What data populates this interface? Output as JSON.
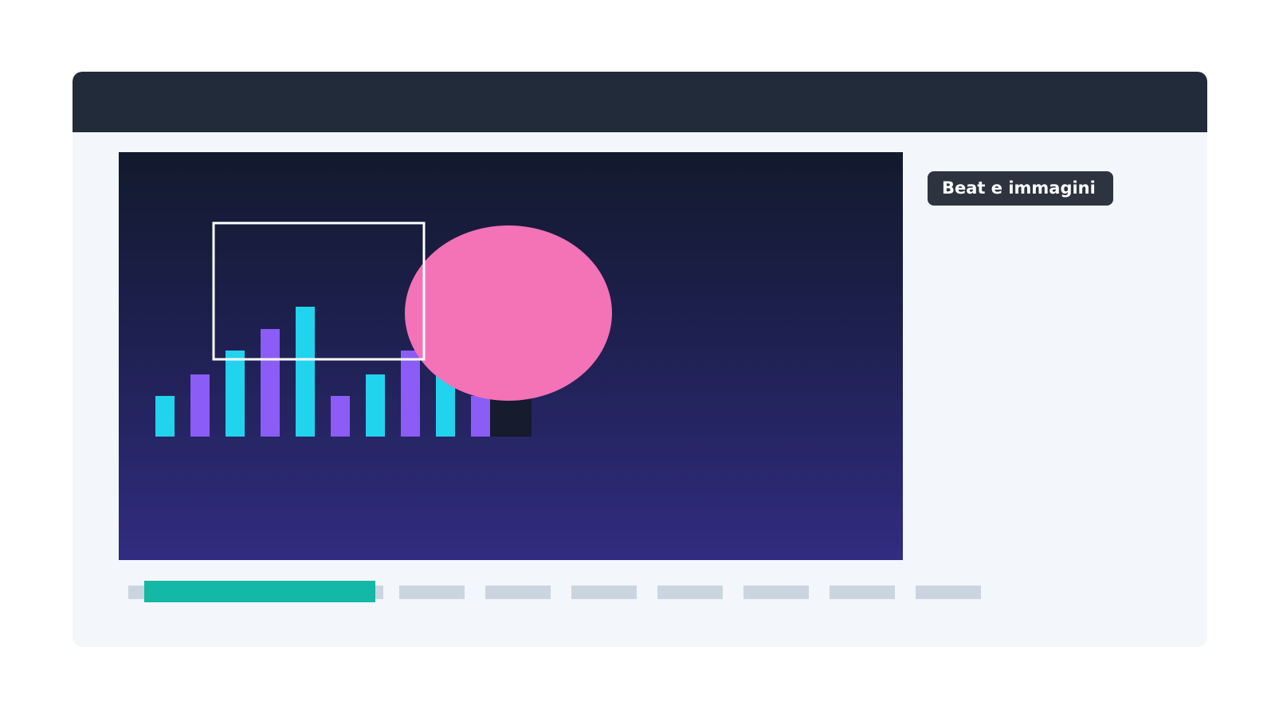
{
  "chip": {
    "label": "Beat e immagini"
  },
  "colors": {
    "background": "#ffffff",
    "window": "#f3f6fa",
    "titlebar": "#212b3a",
    "stage_top": "#121a2d",
    "stage_bottom": "#312c80",
    "bar_cyan": "#22d3ee",
    "bar_purple": "#8b5cf6",
    "circle": "#f472b6",
    "selection_frame": "#ffffff",
    "dark_block": "#161b2e",
    "timeline_track": "#cbd5e1",
    "timeline_progress": "#14b8a6",
    "chip_bg": "#2d3440"
  },
  "visualizer": {
    "bar_levels": [
      0.31,
      0.48,
      0.66,
      0.83,
      1.0,
      0.31,
      0.48,
      0.66,
      0.48,
      0.31
    ],
    "bar_colors": [
      "cyan",
      "purple",
      "cyan",
      "purple",
      "cyan",
      "purple",
      "cyan",
      "purple",
      "cyan",
      "purple"
    ]
  },
  "timeline": {
    "segment_count": 8,
    "progress": 0.3
  },
  "icons": {
    "circle": "pink-circle-shape",
    "frame": "selection-frame",
    "block": "dark-square-shape"
  }
}
